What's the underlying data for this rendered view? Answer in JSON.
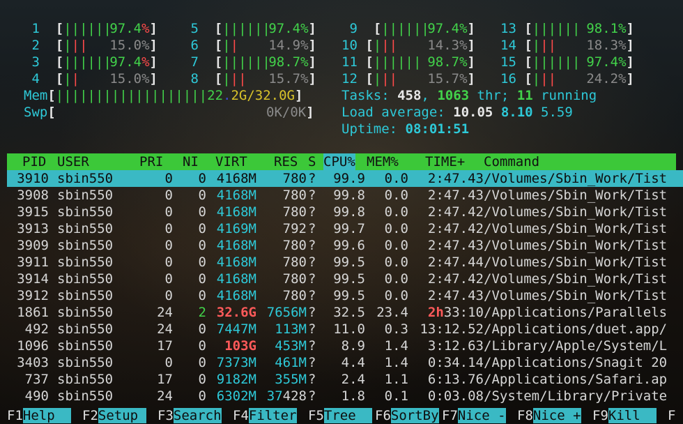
{
  "cpus": [
    {
      "id": "1",
      "bar": "||||||",
      "pct": "97.4",
      "col": 0
    },
    {
      "id": "2",
      "bar": "|||",
      "pct": "15.0%",
      "col": 0
    },
    {
      "id": "3",
      "bar": "||||||",
      "pct": "97.4",
      "col": 0
    },
    {
      "id": "4",
      "bar": "||",
      "pct": "15.0%",
      "col": 0
    },
    {
      "id": "5",
      "bar": "||||||",
      "pct": "97.4%",
      "col": 1
    },
    {
      "id": "6",
      "bar": "||",
      "pct": "14.9%",
      "col": 1
    },
    {
      "id": "7",
      "bar": "||||||",
      "pct": "98.7%",
      "col": 1
    },
    {
      "id": "8",
      "bar": "|||",
      "pct": "15.7%",
      "col": 1
    },
    {
      "id": "9",
      "bar": "||||||",
      "pct": "97.4%",
      "col": 2
    },
    {
      "id": "10",
      "bar": "|||",
      "pct": "14.3%",
      "col": 2
    },
    {
      "id": "11",
      "bar": "||||||",
      "pct": "98.7%",
      "col": 2
    },
    {
      "id": "12",
      "bar": "|||",
      "pct": "15.7%",
      "col": 2
    },
    {
      "id": "13",
      "bar": "||||||",
      "pct": "98.1%",
      "col": 3
    },
    {
      "id": "14",
      "bar": "|||",
      "pct": "18.3%",
      "col": 3
    },
    {
      "id": "15",
      "bar": "||||||",
      "pct": "97.4%",
      "col": 3
    },
    {
      "id": "16",
      "bar": "|||",
      "pct": "24.2%",
      "col": 3
    }
  ],
  "mem": {
    "label": "Mem",
    "bar": "|||||||||||||||||||",
    "value": "22.2G/32.0G"
  },
  "swp": {
    "label": "Swp",
    "value": "0K/0K"
  },
  "tasks": {
    "label": "Tasks:",
    "count": "458",
    "thr": "1063",
    "thr_label": "thr;",
    "running": "11",
    "running_label": "running"
  },
  "load": {
    "label": "Load average:",
    "l1": "10.05",
    "l5": "8.10",
    "l15": "5.59"
  },
  "uptime": {
    "label": "Uptime:",
    "value": "08:01:51"
  },
  "columns": [
    "PID",
    "USER",
    "PRI",
    "NI",
    "VIRT",
    "RES",
    "S",
    "CPU%",
    "MEM%",
    "TIME+",
    "Command"
  ],
  "processes": [
    {
      "pid": "3910",
      "user": "sbin550",
      "pri": "0",
      "ni": "0",
      "virt": "4168M",
      "res": "780",
      "s": "?",
      "cpu": "99.9",
      "mem": "0.0",
      "time": "2:47.43",
      "cmd": "/Volumes/Sbin_Work/Tist"
    },
    {
      "pid": "3908",
      "user": "sbin550",
      "pri": "0",
      "ni": "0",
      "virt": "4168M",
      "res": "780",
      "s": "?",
      "cpu": "99.8",
      "mem": "0.0",
      "time": "2:47.43",
      "cmd": "/Volumes/Sbin_Work/Tist"
    },
    {
      "pid": "3915",
      "user": "sbin550",
      "pri": "0",
      "ni": "0",
      "virt": "4168M",
      "res": "780",
      "s": "?",
      "cpu": "99.8",
      "mem": "0.0",
      "time": "2:47.42",
      "cmd": "/Volumes/Sbin_Work/Tist"
    },
    {
      "pid": "3913",
      "user": "sbin550",
      "pri": "0",
      "ni": "0",
      "virt": "4169M",
      "res": "792",
      "s": "?",
      "cpu": "99.7",
      "mem": "0.0",
      "time": "2:47.42",
      "cmd": "/Volumes/Sbin_Work/Tist"
    },
    {
      "pid": "3909",
      "user": "sbin550",
      "pri": "0",
      "ni": "0",
      "virt": "4168M",
      "res": "780",
      "s": "?",
      "cpu": "99.6",
      "mem": "0.0",
      "time": "2:47.43",
      "cmd": "/Volumes/Sbin_Work/Tist"
    },
    {
      "pid": "3911",
      "user": "sbin550",
      "pri": "0",
      "ni": "0",
      "virt": "4168M",
      "res": "780",
      "s": "?",
      "cpu": "99.5",
      "mem": "0.0",
      "time": "2:47.44",
      "cmd": "/Volumes/Sbin_Work/Tist"
    },
    {
      "pid": "3914",
      "user": "sbin550",
      "pri": "0",
      "ni": "0",
      "virt": "4168M",
      "res": "780",
      "s": "?",
      "cpu": "99.5",
      "mem": "0.0",
      "time": "2:47.42",
      "cmd": "/Volumes/Sbin_Work/Tist"
    },
    {
      "pid": "3912",
      "user": "sbin550",
      "pri": "0",
      "ni": "0",
      "virt": "4168M",
      "res": "780",
      "s": "?",
      "cpu": "99.5",
      "mem": "0.0",
      "time": "2:47.43",
      "cmd": "/Volumes/Sbin_Work/Tist"
    },
    {
      "pid": "1861",
      "user": "sbin550",
      "pri": "24",
      "ni": "2",
      "virt": "32.6G",
      "res": "7656M",
      "s": "?",
      "cpu": "32.5",
      "mem": "23.4",
      "time": "2h33:10",
      "cmd": "/Applications/Parallels"
    },
    {
      "pid": "492",
      "user": "sbin550",
      "pri": "24",
      "ni": "0",
      "virt": "7447M",
      "res": "113M",
      "s": "?",
      "cpu": "11.0",
      "mem": "0.3",
      "time": "13:12.52",
      "cmd": "/Applications/duet.app/"
    },
    {
      "pid": "1096",
      "user": "sbin550",
      "pri": "17",
      "ni": "0",
      "virt": "103G",
      "res": "453M",
      "s": "?",
      "cpu": "8.9",
      "mem": "1.4",
      "time": "3:12.63",
      "cmd": "/Library/Apple/System/L"
    },
    {
      "pid": "3403",
      "user": "sbin550",
      "pri": "0",
      "ni": "0",
      "virt": "7373M",
      "res": "461M",
      "s": "?",
      "cpu": "4.4",
      "mem": "1.4",
      "time": "0:34.14",
      "cmd": "/Applications/Snagit 20"
    },
    {
      "pid": "737",
      "user": "sbin550",
      "pri": "17",
      "ni": "0",
      "virt": "9182M",
      "res": "355M",
      "s": "?",
      "cpu": "2.4",
      "mem": "1.1",
      "time": "6:13.76",
      "cmd": "/Applications/Safari.ap"
    },
    {
      "pid": "490",
      "user": "sbin550",
      "pri": "24",
      "ni": "0",
      "virt": "6302M",
      "res": "37428",
      "s": "?",
      "cpu": "1.8",
      "mem": "0.1",
      "time": "0:03.08",
      "cmd": "/System/Library/Private"
    }
  ],
  "fkeys": [
    {
      "key": "F1",
      "label": "Help  "
    },
    {
      "key": "F2",
      "label": "Setup "
    },
    {
      "key": "F3",
      "label": "Search"
    },
    {
      "key": "F4",
      "label": "Filter"
    },
    {
      "key": "F5",
      "label": "Tree  "
    },
    {
      "key": "F6",
      "label": "SortBy"
    },
    {
      "key": "F7",
      "label": "Nice -"
    },
    {
      "key": "F8",
      "label": "Nice +"
    },
    {
      "key": "F9",
      "label": "Kill  "
    },
    {
      "key": "F",
      "label": ""
    }
  ],
  "colors": {
    "cyan": "#2ec9d8",
    "green": "#42d24a",
    "red": "#ff4a4a",
    "header_green": "#3cc839",
    "select_cyan": "#3ab9c4"
  }
}
